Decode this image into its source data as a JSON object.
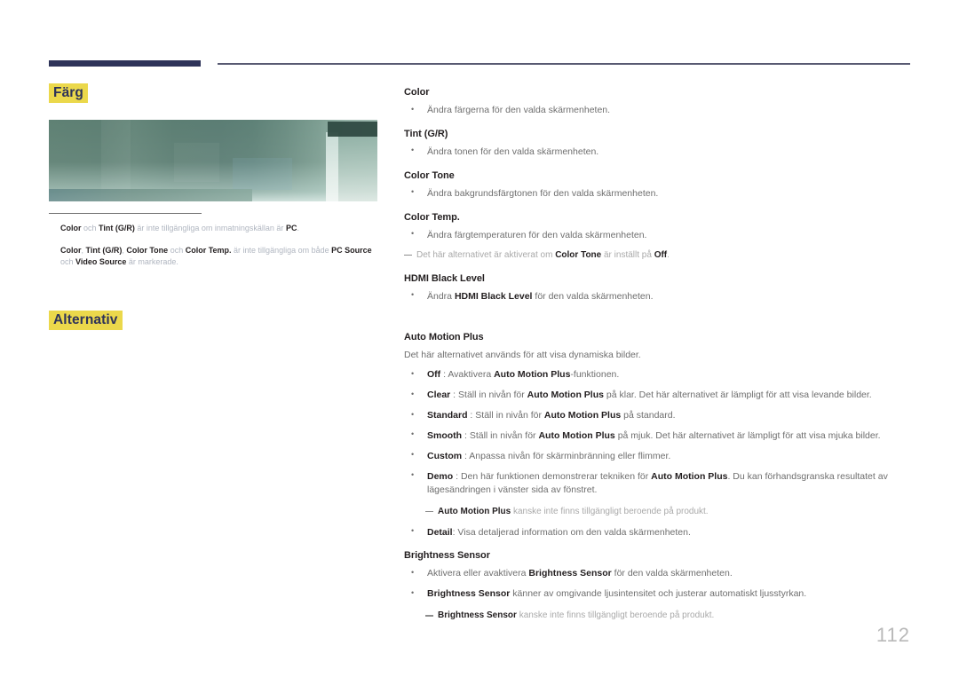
{
  "header": {
    "rule_accent_color": "#2e3359",
    "rule_thin_color": "#585a72"
  },
  "left_column": {
    "section_heading": "Färg",
    "heading_highlight_color": "#ebd84b",
    "heading_text_color": "#2e3359",
    "screenshot_alt": "menyskärmbild",
    "notes": [
      {
        "parts": [
          {
            "text": "Color",
            "bold": true
          },
          {
            "text": " och ",
            "bold": false
          },
          {
            "text": "Tint (G/R)",
            "bold": true
          },
          {
            "text": " är inte tillgängliga om inmatningskällan är ",
            "bold": false
          },
          {
            "text": "PC",
            "bold": true
          },
          {
            "text": ".",
            "bold": false
          }
        ]
      },
      {
        "parts": [
          {
            "text": "Color",
            "bold": true
          },
          {
            "text": ", ",
            "bold": false
          },
          {
            "text": "Tint (G/R)",
            "bold": true
          },
          {
            "text": ", ",
            "bold": false
          },
          {
            "text": "Color Tone",
            "bold": true
          },
          {
            "text": " och ",
            "bold": false
          },
          {
            "text": "Color Temp.",
            "bold": true
          },
          {
            "text": " är inte tillgängliga om både ",
            "bold": false
          },
          {
            "text": "PC Source",
            "bold": true
          },
          {
            "text": " och ",
            "bold": false
          },
          {
            "text": "Video Source",
            "bold": true
          },
          {
            "text": " är markerade.",
            "bold": false
          }
        ]
      }
    ],
    "section_heading_2": "Alternativ"
  },
  "right_column": {
    "blocks": [
      {
        "term": "Color",
        "bullets": [
          {
            "parts": [
              {
                "text": "Ändra färgerna för den valda skärmenheten.",
                "bold": false
              }
            ]
          }
        ]
      },
      {
        "term": "Tint (G/R)",
        "bullets": [
          {
            "parts": [
              {
                "text": "Ändra tonen för den valda skärmenheten.",
                "bold": false
              }
            ]
          }
        ]
      },
      {
        "term": "Color Tone",
        "bullets": [
          {
            "parts": [
              {
                "text": "Ändra bakgrundsfärgtonen för den valda skärmenheten.",
                "bold": false
              }
            ]
          }
        ]
      },
      {
        "term": "Color Temp.",
        "bullets": [
          {
            "parts": [
              {
                "text": "Ändra färgtemperaturen för den valda skärmenheten.",
                "bold": false
              }
            ]
          }
        ],
        "note": {
          "parts": [
            {
              "text": "Det här alternativet är aktiverat om ",
              "bold": false
            },
            {
              "text": "Color Tone",
              "bold": true
            },
            {
              "text": " är inställt på ",
              "bold": false
            },
            {
              "text": "Off",
              "bold": true
            },
            {
              "text": ".",
              "bold": false
            }
          ]
        }
      },
      {
        "term": "HDMI Black Level",
        "bullets": [
          {
            "parts": [
              {
                "text": "Ändra ",
                "bold": false
              },
              {
                "text": "HDMI Black Level",
                "bold": true
              },
              {
                "text": " för den valda skärmenheten.",
                "bold": false
              }
            ]
          }
        ]
      },
      {
        "term": "Auto Motion Plus",
        "intro": "Det här alternativet används för att visa dynamiska bilder.",
        "bullets": [
          {
            "parts": [
              {
                "text": "Off",
                "bold": true
              },
              {
                "text": " : Avaktivera ",
                "bold": false
              },
              {
                "text": "Auto Motion Plus",
                "bold": true
              },
              {
                "text": "-funktionen.",
                "bold": false
              }
            ]
          },
          {
            "parts": [
              {
                "text": "Clear",
                "bold": true
              },
              {
                "text": " : Ställ in nivån för ",
                "bold": false
              },
              {
                "text": "Auto Motion Plus",
                "bold": true
              },
              {
                "text": " på klar. Det här alternativet är lämpligt för att visa levande bilder.",
                "bold": false
              }
            ]
          },
          {
            "parts": [
              {
                "text": "Standard",
                "bold": true
              },
              {
                "text": " : Ställ in nivån för ",
                "bold": false
              },
              {
                "text": "Auto Motion Plus",
                "bold": true
              },
              {
                "text": " på standard.",
                "bold": false
              }
            ]
          },
          {
            "parts": [
              {
                "text": "Smooth",
                "bold": true
              },
              {
                "text": " : Ställ in nivån för ",
                "bold": false
              },
              {
                "text": "Auto Motion Plus",
                "bold": true
              },
              {
                "text": " på mjuk. Det här alternativet är lämpligt för att visa mjuka bilder.",
                "bold": false
              }
            ]
          },
          {
            "parts": [
              {
                "text": "Custom",
                "bold": true
              },
              {
                "text": " : Anpassa nivån för skärminbränning eller flimmer.",
                "bold": false
              }
            ]
          },
          {
            "parts": [
              {
                "text": "Demo",
                "bold": true
              },
              {
                "text": " : Den här funktionen demonstrerar tekniken för ",
                "bold": false
              },
              {
                "text": "Auto Motion Plus",
                "bold": true
              },
              {
                "text": ". Du kan förhandsgranska resultatet av lägesändringen i vänster sida av fönstret.",
                "bold": false
              }
            ]
          }
        ],
        "inline_note": {
          "parts": [
            {
              "text": "Auto Motion Plus",
              "bold": true
            },
            {
              "text": " kanske inte finns tillgängligt beroende på produkt.",
              "bold": false
            }
          ]
        },
        "bullets_after": [
          {
            "parts": [
              {
                "text": "Detail",
                "bold": true
              },
              {
                "text": ": Visa detaljerad information om den valda skärmenheten.",
                "bold": false
              }
            ]
          }
        ]
      },
      {
        "term": "Brightness Sensor",
        "bullets": [
          {
            "parts": [
              {
                "text": "Aktivera eller avaktivera ",
                "bold": false
              },
              {
                "text": "Brightness Sensor",
                "bold": true
              },
              {
                "text": " för den valda skärmenheten.",
                "bold": false
              }
            ]
          },
          {
            "parts": [
              {
                "text": "Brightness Sensor",
                "bold": true
              },
              {
                "text": " känner av omgivande ljusintensitet och justerar automatiskt ljusstyrkan.",
                "bold": false
              }
            ]
          }
        ],
        "note_flush": {
          "parts": [
            {
              "text": "Brightness Sensor",
              "bold": true
            },
            {
              "text": " kanske inte finns tillgängligt beroende på produkt.",
              "bold": false
            }
          ]
        }
      }
    ]
  },
  "footer": {
    "page_number": "112"
  }
}
